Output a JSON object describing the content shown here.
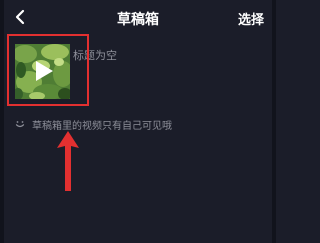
{
  "header": {
    "title": "草稿箱",
    "select_label": "选择",
    "back_icon": "chevron-left-icon"
  },
  "draft": {
    "title": "标题为空",
    "play_icon": "play-icon"
  },
  "tip": {
    "text": "草稿箱里的视频只有自己可见哦",
    "icon": "smile-icon"
  },
  "colors": {
    "background": "#1b1d29",
    "text_primary": "#ffffff",
    "text_secondary": "#8d8f99",
    "annotation": "#e33030"
  }
}
